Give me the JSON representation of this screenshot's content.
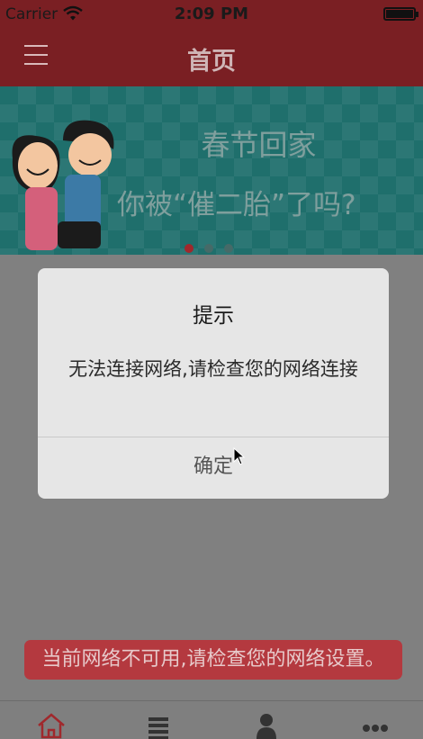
{
  "status_bar": {
    "carrier": "Carrier",
    "time": "2:09 PM"
  },
  "nav": {
    "title": "首页",
    "menu_icon": "hamburger-icon"
  },
  "banner": {
    "line1": "春节回家",
    "line2": "你被“催二胎”了吗?",
    "page_count": 3,
    "active_page": 1
  },
  "dialog": {
    "title": "提示",
    "message": "无法连接网络,请检查您的网络连接",
    "confirm_label": "确定"
  },
  "toast": {
    "text": "当前网络不可用,请检查您的网络设置。"
  },
  "tabbar": {
    "items": [
      {
        "icon": "home-icon",
        "active": true
      },
      {
        "icon": "list-icon",
        "active": false
      },
      {
        "icon": "user-icon",
        "active": false
      },
      {
        "icon": "more-icon",
        "active": false
      }
    ]
  },
  "colors": {
    "nav_bg": "#7a1f23",
    "banner_bg": "#1f6f6c",
    "toast_bg": "#b4393f",
    "accent": "#a0282c"
  }
}
